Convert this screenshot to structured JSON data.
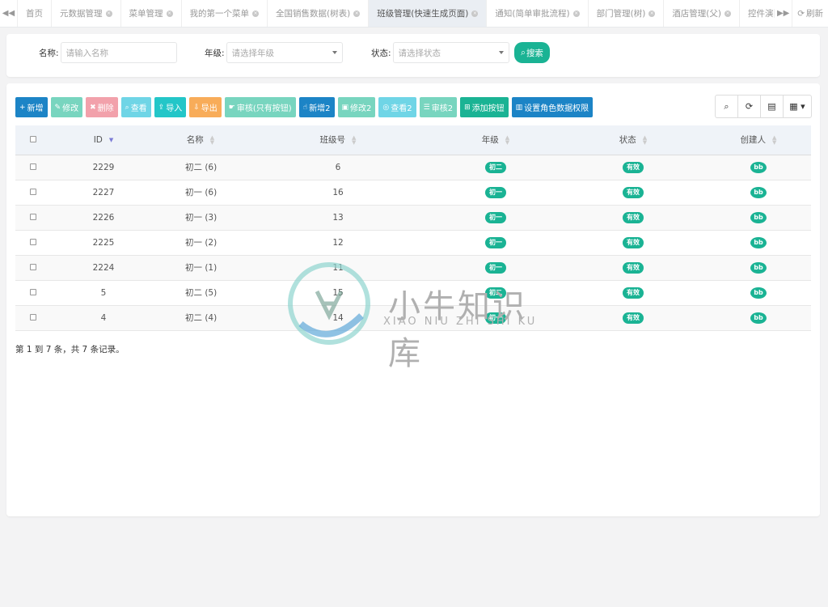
{
  "tabs": [
    {
      "label": "首页",
      "closable": false,
      "active": false
    },
    {
      "label": "元数据管理",
      "closable": true,
      "active": false
    },
    {
      "label": "菜单管理",
      "closable": true,
      "active": false
    },
    {
      "label": "我的第一个菜单",
      "closable": true,
      "active": false
    },
    {
      "label": "全国销售数据(树表)",
      "closable": true,
      "active": false
    },
    {
      "label": "班级管理(快速生成页面)",
      "closable": true,
      "active": true
    },
    {
      "label": "通知(简单审批流程)",
      "closable": true,
      "active": false
    },
    {
      "label": "部门管理(树)",
      "closable": true,
      "active": false
    },
    {
      "label": "酒店管理(父)",
      "closable": true,
      "active": false
    },
    {
      "label": "控件演示",
      "closable": true,
      "active": false
    }
  ],
  "refresh_label": "刷新",
  "search": {
    "name_label": "名称:",
    "name_placeholder": "请输入名称",
    "grade_label": "年级:",
    "grade_placeholder": "请选择年级",
    "status_label": "状态:",
    "status_placeholder": "请选择状态",
    "search_label": "搜索"
  },
  "toolbar": [
    {
      "label": "新增",
      "icon": "+",
      "color": "#1c84c6"
    },
    {
      "label": "修改",
      "icon": "✎",
      "color": "#78d5bf"
    },
    {
      "label": "删除",
      "icon": "✖",
      "color": "#f2a1ab"
    },
    {
      "label": "查看",
      "icon": "⌕",
      "color": "#6fd5e6"
    },
    {
      "label": "导入",
      "icon": "⇪",
      "color": "#23c6c8"
    },
    {
      "label": "导出",
      "icon": "⇩",
      "color": "#f8ac59"
    },
    {
      "label": "审核(只有按钮)",
      "icon": "☛",
      "color": "#78d5bf"
    },
    {
      "label": "新增2",
      "icon": "☝",
      "color": "#1c84c6"
    },
    {
      "label": "修改2",
      "icon": "▣",
      "color": "#78d5bf"
    },
    {
      "label": "查看2",
      "icon": "◎",
      "color": "#6fd5e6"
    },
    {
      "label": "审核2",
      "icon": "☰",
      "color": "#78d5bf"
    },
    {
      "label": "添加按钮",
      "icon": "⊞",
      "color": "#1ab394"
    },
    {
      "label": "设置角色数据权限",
      "icon": "▥",
      "color": "#1c84c6"
    }
  ],
  "columns": [
    "ID",
    "名称",
    "班级号",
    "年级",
    "状态",
    "创建人"
  ],
  "rows": [
    {
      "id": "2229",
      "name": "初二 (6)",
      "class_no": "6",
      "grade": "初二",
      "status": "有效",
      "creator": "bb"
    },
    {
      "id": "2227",
      "name": "初一 (6)",
      "class_no": "16",
      "grade": "初一",
      "status": "有效",
      "creator": "bb"
    },
    {
      "id": "2226",
      "name": "初一 (3)",
      "class_no": "13",
      "grade": "初一",
      "status": "有效",
      "creator": "bb"
    },
    {
      "id": "2225",
      "name": "初一 (2)",
      "class_no": "12",
      "grade": "初一",
      "status": "有效",
      "creator": "bb"
    },
    {
      "id": "2224",
      "name": "初一 (1)",
      "class_no": "11",
      "grade": "初一",
      "status": "有效",
      "creator": "bb"
    },
    {
      "id": "5",
      "name": "初二 (5)",
      "class_no": "15",
      "grade": "初二",
      "status": "有效",
      "creator": "bb"
    },
    {
      "id": "4",
      "name": "初二 (4)",
      "class_no": "14",
      "grade": "初一",
      "status": "有效",
      "creator": "bb"
    }
  ],
  "pager_text": "第 1 到 7 条，共 7 条记录。",
  "watermark": {
    "title": "小牛知识库",
    "subtitle": "XIAO NIU ZHI SHI KU"
  },
  "colors": {
    "accent": "#1ab394",
    "primary": "#1c84c6"
  }
}
